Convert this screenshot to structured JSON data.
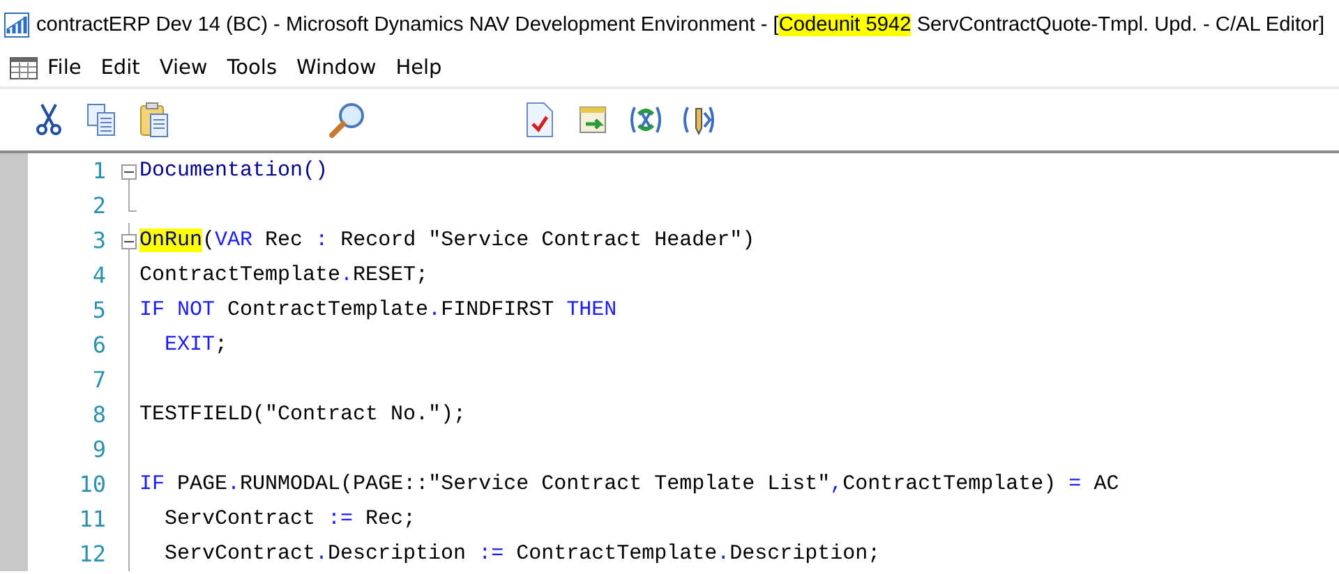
{
  "window": {
    "title": [
      {
        "text": "contractERP Dev 14 (BC) - Microsoft Dynamics NAV Development Environment - [",
        "highlighted": false
      },
      {
        "text": "Codeunit 5942",
        "highlighted": true
      },
      {
        "text": " ServContractQuote-Tmpl. Upd. - C/AL Editor]",
        "highlighted": false
      }
    ]
  },
  "menu": [
    "File",
    "Edit",
    "View",
    "Tools",
    "Window",
    "Help"
  ],
  "toolbar": [
    {
      "kind": "cut"
    },
    {
      "kind": "copy"
    },
    {
      "kind": "paste"
    },
    {
      "kind": "gap"
    },
    {
      "kind": "find"
    },
    {
      "kind": "gap"
    },
    {
      "kind": "check"
    },
    {
      "kind": "run"
    },
    {
      "kind": "sync"
    },
    {
      "kind": "debug"
    }
  ],
  "editor": {
    "lines": [
      {
        "number": "1",
        "kind": "header",
        "expanded": true,
        "tokens": [
          {
            "text": "Documentation()",
            "kind": "name",
            "highlighted": false
          }
        ]
      },
      {
        "number": "2",
        "kind": "end"
      },
      {
        "number": "3",
        "kind": "header",
        "expanded": true,
        "tokens": [
          {
            "text": "OnRun",
            "kind": "name",
            "highlighted": true
          },
          {
            "text": "(",
            "kind": "plain",
            "highlighted": false
          },
          {
            "text": "VAR",
            "kind": "keyword",
            "highlighted": false
          },
          {
            "text": " Rec ",
            "kind": "plain",
            "highlighted": false
          },
          {
            "text": ":",
            "kind": "keyword",
            "highlighted": false
          },
          {
            "text": " Record \"Service Contract Header\")",
            "kind": "plain",
            "highlighted": false
          }
        ]
      },
      {
        "number": "4",
        "kind": "body",
        "tokens": [
          {
            "text": "ContractTemplate",
            "kind": "plain",
            "highlighted": false
          },
          {
            "text": ".",
            "kind": "keyword",
            "highlighted": false
          },
          {
            "text": "RESET;",
            "kind": "plain",
            "highlighted": false
          }
        ]
      },
      {
        "number": "5",
        "kind": "body",
        "tokens": [
          {
            "text": "IF NOT",
            "kind": "keyword",
            "highlighted": false
          },
          {
            "text": " ContractTemplate",
            "kind": "plain",
            "highlighted": false
          },
          {
            "text": ".",
            "kind": "keyword",
            "highlighted": false
          },
          {
            "text": "FINDFIRST ",
            "kind": "plain",
            "highlighted": false
          },
          {
            "text": "THEN",
            "kind": "keyword",
            "highlighted": false
          }
        ]
      },
      {
        "number": "6",
        "kind": "body",
        "tokens": [
          {
            "text": "  EXIT",
            "kind": "keyword",
            "highlighted": false
          },
          {
            "text": ";",
            "kind": "plain",
            "highlighted": false
          }
        ]
      },
      {
        "number": "7",
        "kind": "body"
      },
      {
        "number": "8",
        "kind": "body",
        "tokens": [
          {
            "text": "TESTFIELD(\"Contract No.\");",
            "kind": "plain",
            "highlighted": false
          }
        ]
      },
      {
        "number": "9",
        "kind": "body"
      },
      {
        "number": "10",
        "kind": "body",
        "tokens": [
          {
            "text": "IF",
            "kind": "keyword",
            "highlighted": false
          },
          {
            "text": " PAGE",
            "kind": "plain",
            "highlighted": false
          },
          {
            "text": ".",
            "kind": "keyword",
            "highlighted": false
          },
          {
            "text": "RUNMODAL(PAGE::\"Service Contract Template List\"",
            "kind": "plain",
            "highlighted": false
          },
          {
            "text": ",",
            "kind": "keyword",
            "highlighted": false
          },
          {
            "text": "ContractTemplate) ",
            "kind": "plain",
            "highlighted": false
          },
          {
            "text": "=",
            "kind": "keyword",
            "highlighted": false
          },
          {
            "text": " AC",
            "kind": "plain",
            "highlighted": false
          }
        ]
      },
      {
        "number": "11",
        "kind": "body",
        "tokens": [
          {
            "text": "  ServContract ",
            "kind": "plain",
            "highlighted": false
          },
          {
            "text": ":=",
            "kind": "keyword",
            "highlighted": false
          },
          {
            "text": " Rec;",
            "kind": "plain",
            "highlighted": false
          }
        ]
      },
      {
        "number": "12",
        "kind": "body",
        "tokens": [
          {
            "text": "  ServContract",
            "kind": "plain",
            "highlighted": false
          },
          {
            "text": ".",
            "kind": "keyword",
            "highlighted": false
          },
          {
            "text": "Description ",
            "kind": "plain",
            "highlighted": false
          },
          {
            "text": ":=",
            "kind": "keyword",
            "highlighted": false
          },
          {
            "text": " ContractTemplate",
            "kind": "plain",
            "highlighted": false
          },
          {
            "text": ".",
            "kind": "keyword",
            "highlighted": false
          },
          {
            "text": "Description;",
            "kind": "plain",
            "highlighted": false
          }
        ]
      }
    ]
  }
}
